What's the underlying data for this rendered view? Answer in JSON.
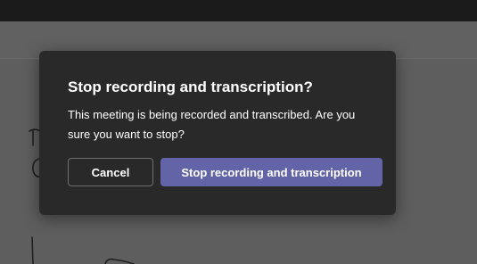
{
  "dialog": {
    "title": "Stop recording and transcription?",
    "body": "This meeting is being recorded and transcribed. Are you sure you want to stop?",
    "cancel_label": "Cancel",
    "confirm_label": "Stop recording and transcription"
  },
  "colors": {
    "dialog_background": "#292929",
    "primary_button": "#6264a7",
    "overlay": "#5f5f5f",
    "top_bar": "#1b1b1b"
  }
}
